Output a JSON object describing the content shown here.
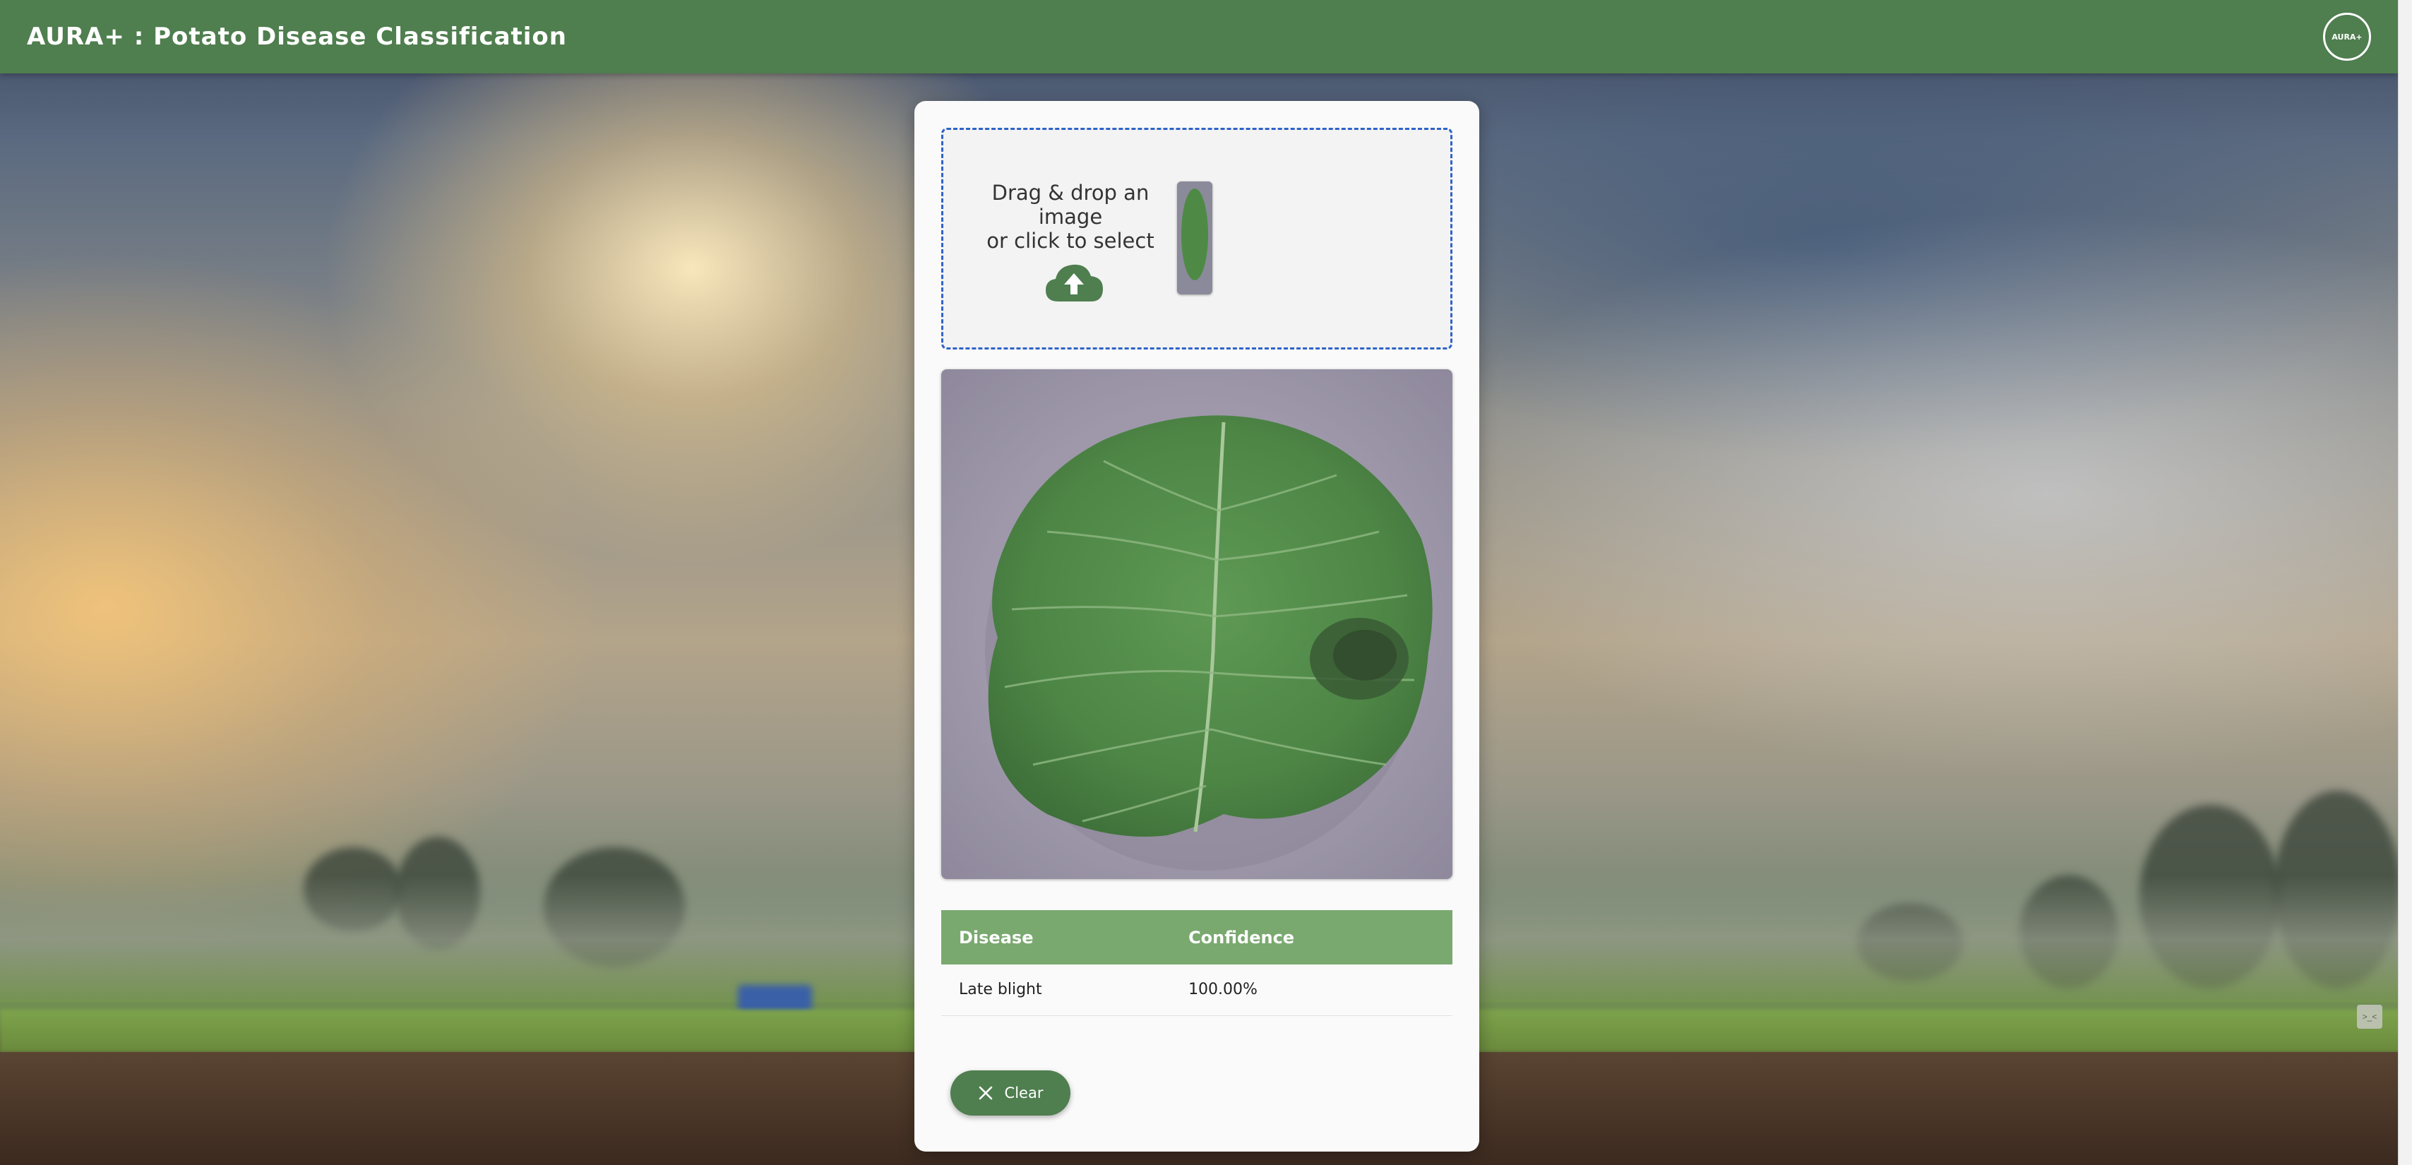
{
  "header": {
    "title": "AURA+ : Potato Disease Classification",
    "logo_text": "AURA+",
    "color": "#4f7e4f"
  },
  "dropzone": {
    "line1": "Drag & drop an image",
    "line2": "or click to select",
    "upload_icon": "cloud-upload-icon",
    "border_color": "#2f63c8"
  },
  "results": {
    "headers": [
      "Disease",
      "Confidence"
    ],
    "rows": [
      {
        "disease": "Late blight",
        "confidence": "100.00%"
      }
    ],
    "header_color": "#7aa96f"
  },
  "actions": {
    "clear_label": "Clear",
    "clear_icon": "close-icon"
  }
}
